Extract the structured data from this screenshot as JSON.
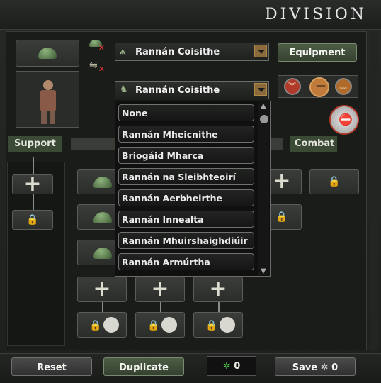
{
  "window": {
    "title": "Division"
  },
  "top": {
    "template_dropdown_value": "Rannán Coisithe",
    "equipment_button": "Equipment",
    "division_dropdown_value": "Rannán Coisithe"
  },
  "tabs": {
    "support": "Support",
    "combat": "Combat"
  },
  "dropdown_list": {
    "options": [
      "None",
      "Rannán Mheicnithe",
      "Briogáid Mharca",
      "Rannán na Sleibhteoirí",
      "Rannán Aerbheirthe",
      "Rannán Innealta",
      "Rannán Mhuirshaighdiúir",
      "Rannán Armúrtha"
    ]
  },
  "bottom": {
    "reset": "Reset",
    "duplicate": "Duplicate",
    "cost_value": "0",
    "save_label": "Save",
    "save_cost": "0"
  },
  "colors": {
    "accent_green": "#34412f",
    "dropdown_arrow": "#8a6a3a",
    "stat_red": "#b03a2a"
  }
}
